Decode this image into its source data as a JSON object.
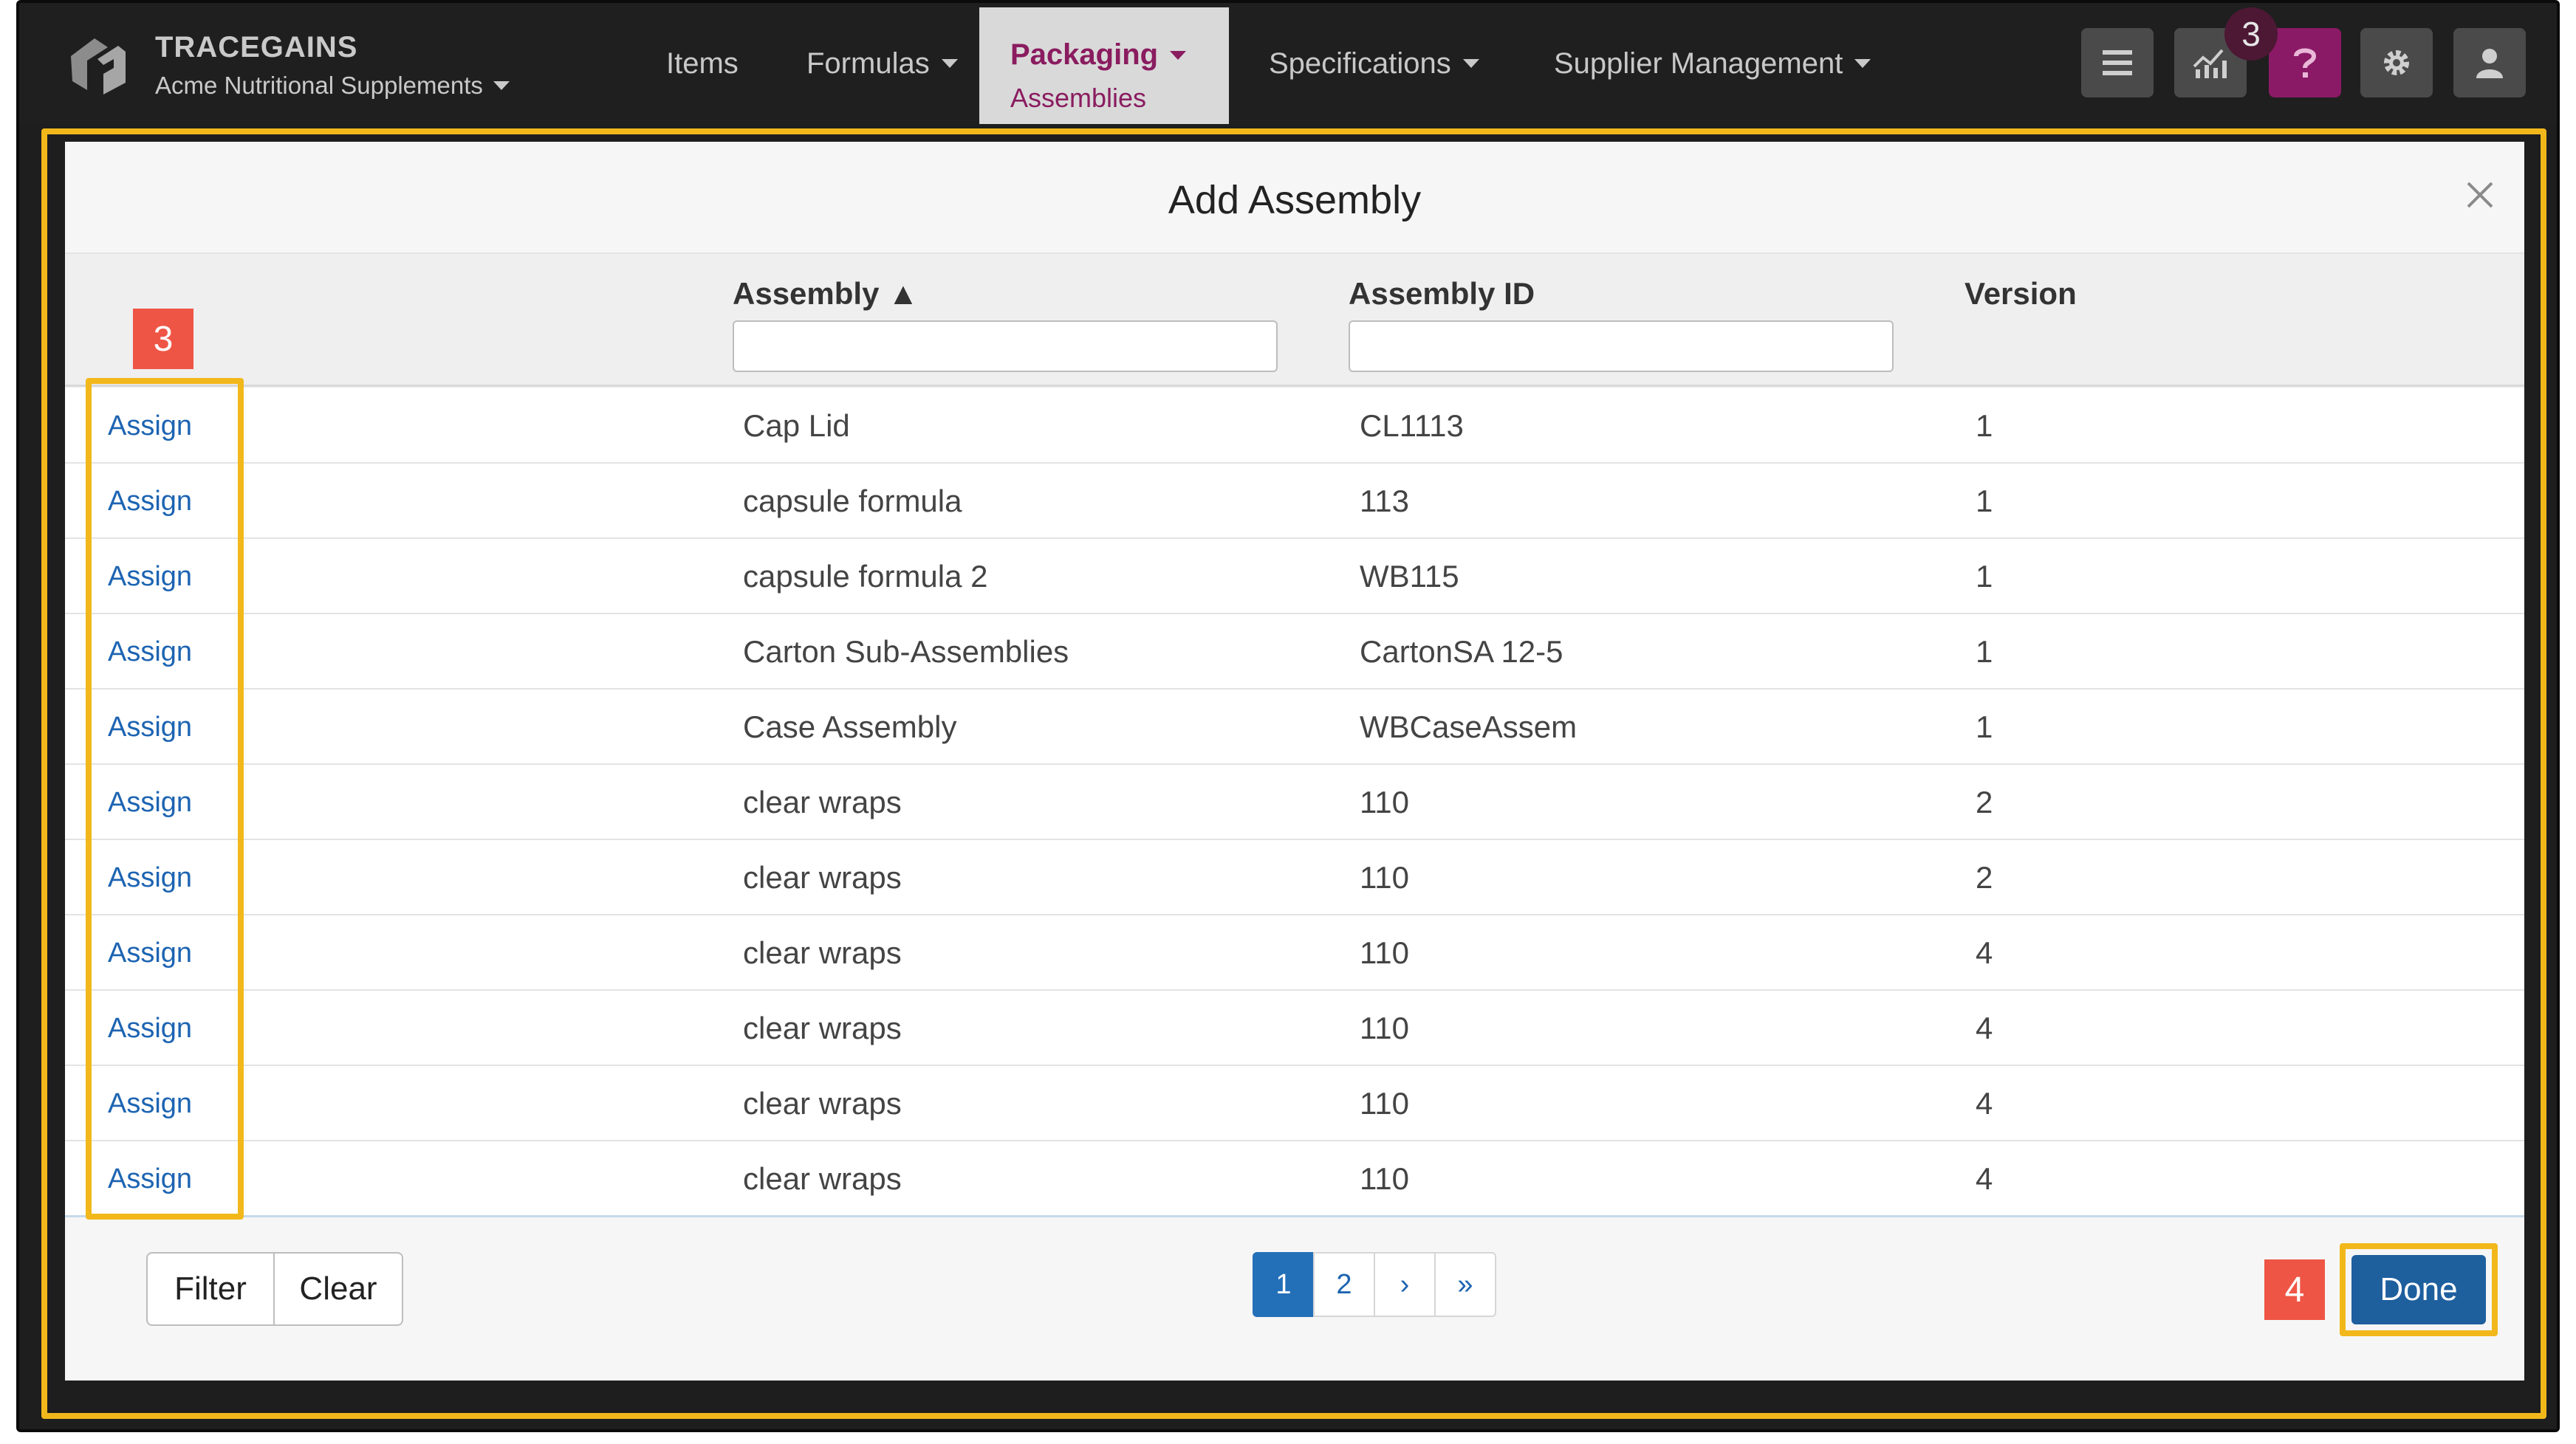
{
  "brand": {
    "name": "TRACEGAINS",
    "company": "Acme Nutritional Supplements"
  },
  "nav": {
    "items": [
      "Items",
      "Formulas",
      "Packaging",
      "Specifications",
      "Supplier Management"
    ],
    "active_sub": "Assemblies",
    "notification_count": "3"
  },
  "modal": {
    "title": "Add Assembly",
    "columns": {
      "assembly": "Assembly ▲",
      "assembly_id": "Assembly ID",
      "version": "Version"
    },
    "assign_label": "Assign",
    "rows": [
      {
        "name": "Cap Lid",
        "id": "CL1113",
        "version": "1"
      },
      {
        "name": "capsule formula",
        "id": "113",
        "version": "1"
      },
      {
        "name": "capsule formula 2",
        "id": "WB115",
        "version": "1"
      },
      {
        "name": "Carton Sub-Assemblies",
        "id": "CartonSA 12-5",
        "version": "1"
      },
      {
        "name": "Case Assembly",
        "id": "WBCaseAssem",
        "version": "1"
      },
      {
        "name": "clear wraps",
        "id": "110",
        "version": "2"
      },
      {
        "name": "clear wraps",
        "id": "110",
        "version": "2"
      },
      {
        "name": "clear wraps",
        "id": "110",
        "version": "4"
      },
      {
        "name": "clear wraps",
        "id": "110",
        "version": "4"
      },
      {
        "name": "clear wraps",
        "id": "110",
        "version": "4"
      },
      {
        "name": "clear wraps",
        "id": "110",
        "version": "4"
      }
    ],
    "filter_label": "Filter",
    "clear_label": "Clear",
    "pagination": [
      "1",
      "2",
      "›",
      "»"
    ],
    "done_label": "Done"
  },
  "steps": {
    "assign_step": "3",
    "done_step": "4"
  },
  "colors": {
    "highlight": "#f2b81b",
    "step": "#ef5545",
    "primary": "#1e5f9e",
    "brand_active": "#8a1c5f"
  }
}
